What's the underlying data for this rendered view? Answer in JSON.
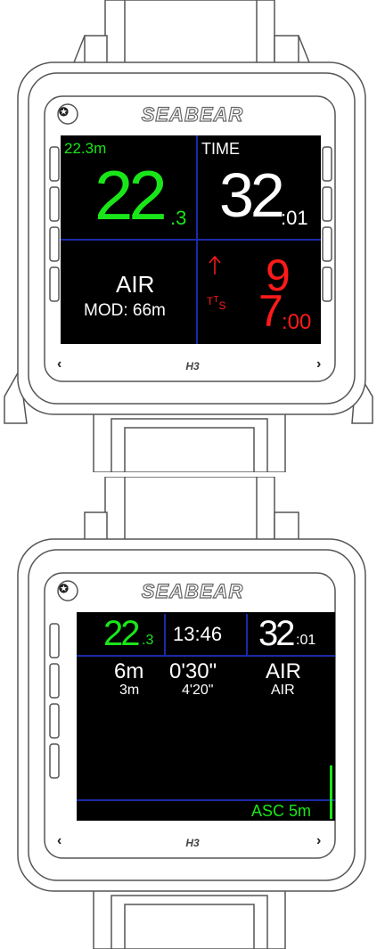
{
  "brand": "SEABEAR",
  "model": "H3",
  "watch1": {
    "max_depth": "22.3m",
    "depth_main": "22",
    "depth_decimal": ".3",
    "time_label": "TIME",
    "time_main": "32",
    "time_seconds": ":01",
    "gas": "AIR",
    "mod": "MOD: 66m",
    "ascent_icon": "up-arrow-icon",
    "tts_label": "TTS",
    "ndl_value": "9",
    "tts_main": "7",
    "tts_seconds": ":00"
  },
  "watch2": {
    "depth_main": "22",
    "depth_decimal": ".3",
    "clock": "13:46",
    "time_main": "32",
    "time_seconds": ":01",
    "stop_depth": "6m",
    "stop_depth_sub": "3m",
    "stop_time": "0'30\"",
    "stop_time_sub": "4'20\"",
    "gas": "AIR",
    "gas_sub": "AIR",
    "asc_label": "ASC 5m"
  },
  "colors": {
    "depth": "#19e619",
    "warning": "#ff1a1a",
    "divider": "#1a2aa8",
    "text": "#ffffff"
  }
}
